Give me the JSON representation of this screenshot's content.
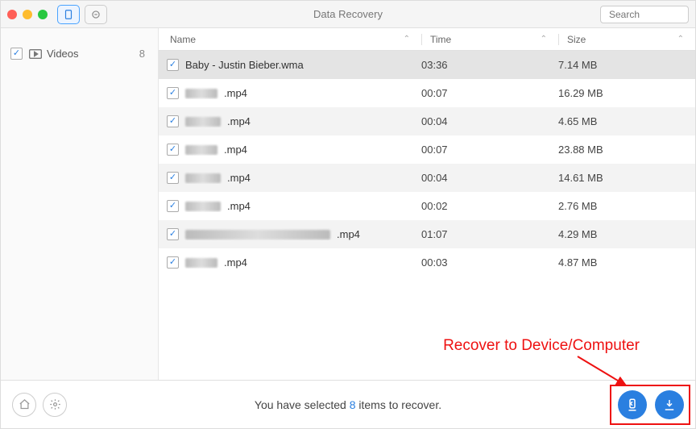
{
  "window": {
    "title": "Data Recovery",
    "search_placeholder": "Search"
  },
  "sidebar": {
    "items": [
      {
        "label": "Videos",
        "count": "8"
      }
    ]
  },
  "table": {
    "headers": {
      "name": "Name",
      "time": "Time",
      "size": "Size"
    },
    "rows": [
      {
        "name": "Baby - Justin Bieber.wma",
        "time": "03:36",
        "size": "7.14 MB",
        "redacted": false
      },
      {
        "name": ".mp4",
        "time": "00:07",
        "size": "16.29 MB",
        "redacted": true,
        "blur_w": 40
      },
      {
        "name": ".mp4",
        "time": "00:04",
        "size": "4.65 MB",
        "redacted": true,
        "blur_w": 44
      },
      {
        "name": ".mp4",
        "time": "00:07",
        "size": "23.88 MB",
        "redacted": true,
        "blur_w": 40
      },
      {
        "name": ".mp4",
        "time": "00:04",
        "size": "14.61 MB",
        "redacted": true,
        "blur_w": 44
      },
      {
        "name": ".mp4",
        "time": "00:02",
        "size": "2.76 MB",
        "redacted": true,
        "blur_w": 44
      },
      {
        "name": ".mp4",
        "time": "01:07",
        "size": "4.29 MB",
        "redacted": true,
        "blur_w": 180
      },
      {
        "name": ".mp4",
        "time": "00:03",
        "size": "4.87 MB",
        "redacted": true,
        "blur_w": 40
      }
    ]
  },
  "footer": {
    "text_pre": "You have selected ",
    "count": "8",
    "text_post": " items to recover."
  },
  "annotation": {
    "label": "Recover to Device/Computer"
  }
}
